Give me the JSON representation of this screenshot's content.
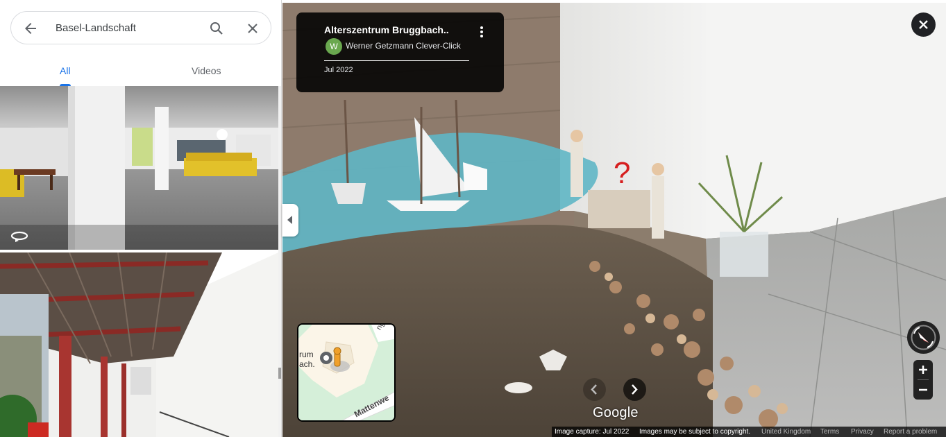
{
  "search": {
    "query": "Basel-Landschaft"
  },
  "tabs": [
    {
      "label": "All",
      "active": true
    },
    {
      "label": "Videos",
      "active": false
    }
  ],
  "photo_card": {
    "title": "Alterszentrum Bruggbach..",
    "author_initial": "W",
    "author": "Werner Getzmann Clever-Click",
    "date": "Jul 2022"
  },
  "minimap": {
    "place_line1": "rum",
    "place_line2": "ach.",
    "road1": "ng",
    "road2": "Mattenwe"
  },
  "branding": {
    "logo": "Google"
  },
  "footer": {
    "capture": "Image capture: Jul 2022",
    "copyright": "Images may be subject to copyright.",
    "region": "United Kingdom",
    "terms": "Terms",
    "privacy": "Privacy",
    "report": "Report a problem"
  },
  "colors": {
    "accent": "#1a73e8",
    "avatar": "#6aa84f",
    "compass_needle": "#e53935"
  }
}
